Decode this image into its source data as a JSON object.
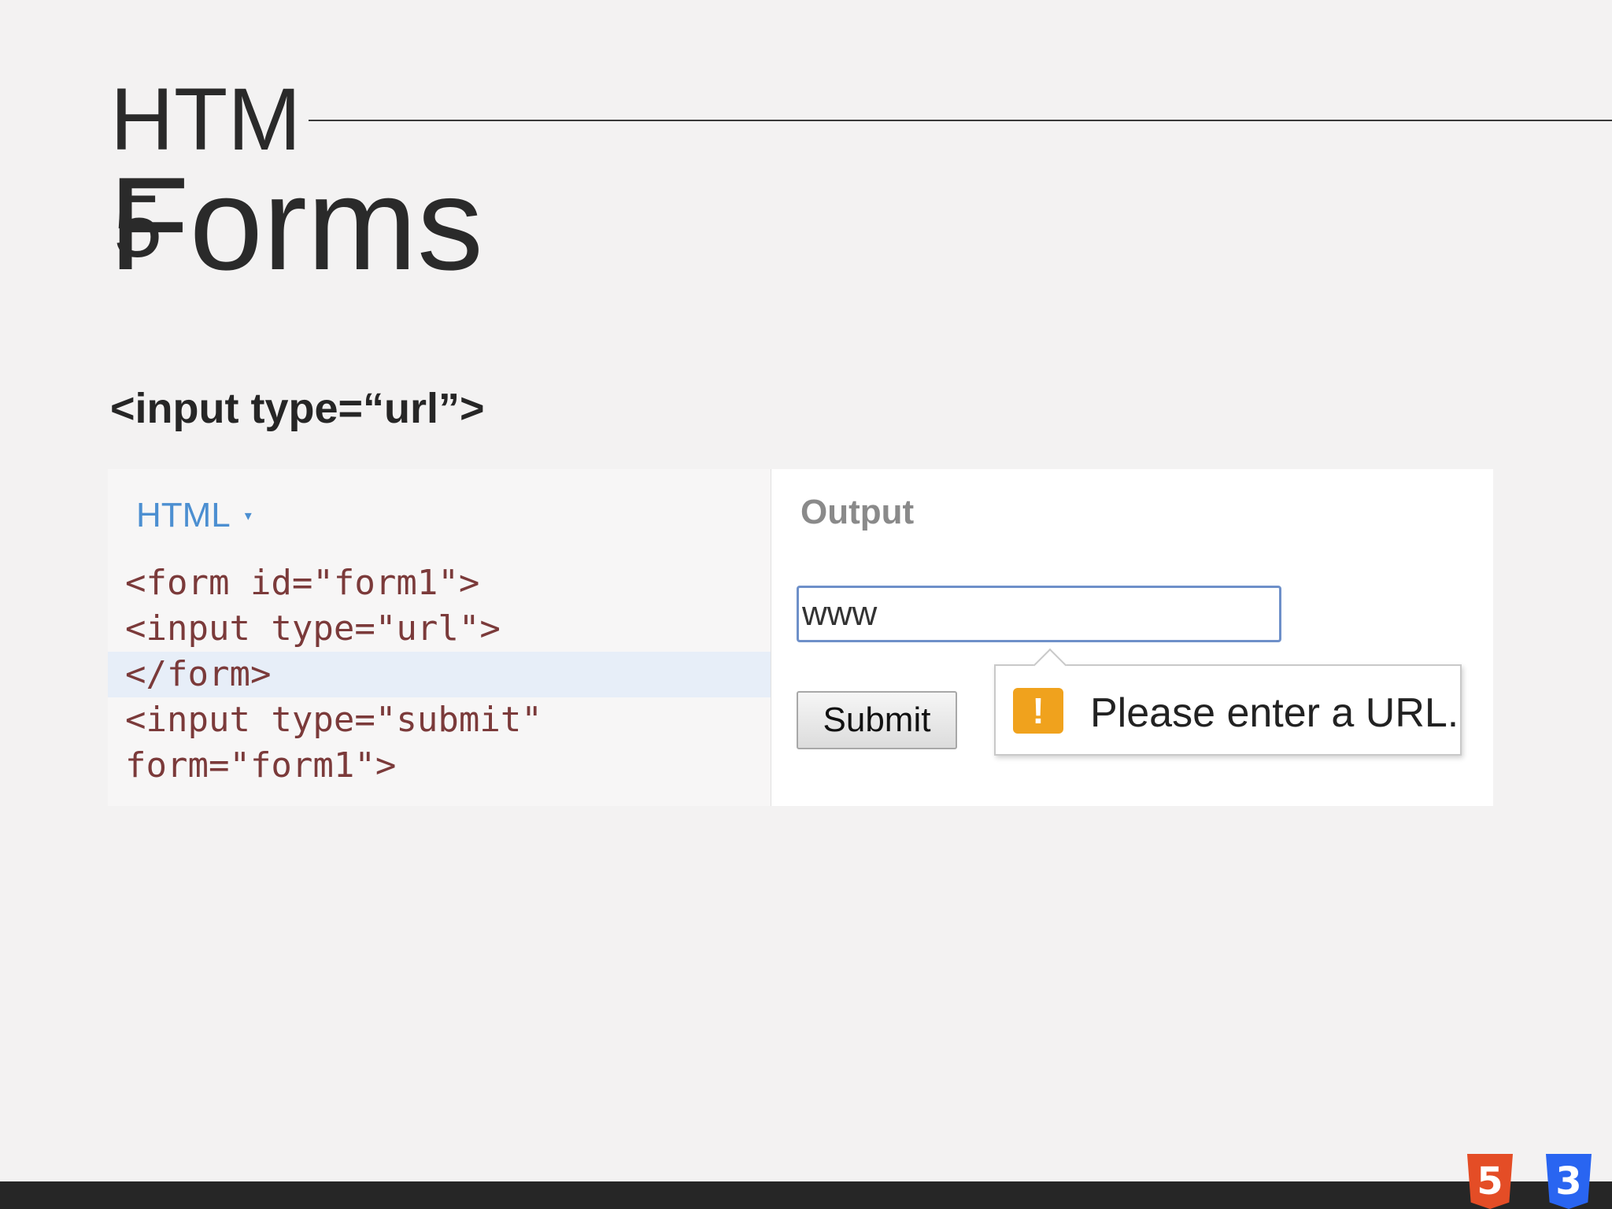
{
  "slide": {
    "title_part1": "HTM",
    "title_part2": "5",
    "title_word": "Forms",
    "subtitle": "<input type=“url”>"
  },
  "editor": {
    "tab_label": "HTML",
    "tab_caret": "▾",
    "code_lines": [
      "<form id=\"form1\">",
      "<input type=\"url\">",
      "</form>",
      "<input type=\"submit\"",
      "form=\"form1\">"
    ]
  },
  "output": {
    "label": "Output",
    "input_value": "www",
    "submit_label": "Submit",
    "validation_icon": "!",
    "validation_message": "Please enter a URL."
  },
  "logos": {
    "html5_label": "5",
    "css3_label": "3"
  },
  "colors": {
    "background": "#f3f2f2",
    "html5": "#e44d26",
    "css3": "#2965f1",
    "warning": "#f0a21d",
    "code_tab": "#4c8fd1"
  },
  "icons": [
    "warning-icon",
    "html5-logo-icon",
    "css3-logo-icon",
    "dropdown-caret-icon"
  ]
}
